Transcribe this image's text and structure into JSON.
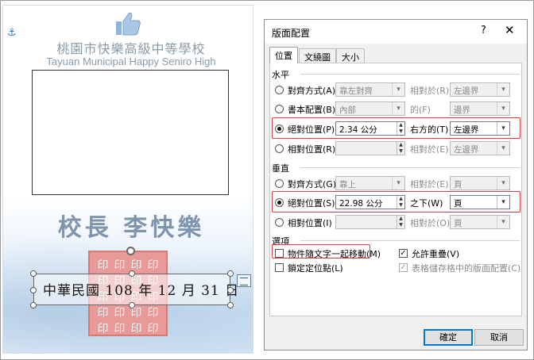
{
  "document": {
    "school_name_cn": "桃園市快樂高級中等學校",
    "school_name_en": "Tayuan Municipal Happy Seniro High School",
    "principal": "校長 李快樂",
    "date_text": "中華民國 108 年 12 月 31 日",
    "seal_char": "印",
    "icons": [
      "anchor-icon",
      "thumbs-up-icon",
      "layout-options-icon",
      "rotate-handle-icon"
    ]
  },
  "dialog": {
    "title": "版面配置",
    "help": "?",
    "close": "✕",
    "tabs": [
      "位置",
      "文繞圖",
      "大小"
    ],
    "horizontal": {
      "section": "水平",
      "align": {
        "label": "對齊方式(A)",
        "value": "靠左對齊",
        "rel_label": "相對於(R)",
        "rel_value": "左邊界"
      },
      "book": {
        "label": "書本配置(B)",
        "value": "內部",
        "rel_label": "的(F)",
        "rel_value": "邊界"
      },
      "absolute": {
        "label": "絕對位置(P)",
        "value": "2.34 公分",
        "rel_label": "右方的(T)",
        "rel_value": "左邊界"
      },
      "relative": {
        "label": "相對位置(R)",
        "value": "",
        "rel_label": "相對於(E)",
        "rel_value": "左邊界"
      }
    },
    "vertical": {
      "section": "垂直",
      "align": {
        "label": "對齊方式(G)",
        "value": "靠上",
        "rel_label": "相對於(E)",
        "rel_value": "頁"
      },
      "absolute": {
        "label": "絕對位置(S)",
        "value": "22.98 公分",
        "rel_label": "之下(W)",
        "rel_value": "頁"
      },
      "relative": {
        "label": "相對位置(I)",
        "value": "",
        "rel_label": "相對於(O)",
        "rel_value": "頁"
      }
    },
    "options": {
      "section": "選項",
      "move_with_text": "物件隨文字一起移動(M)",
      "lock_anchor": "鎖定定位點(L)",
      "allow_overlap": "允許重疊(V)",
      "layout_in_table": "表格儲存格中的版面配置(C)"
    },
    "ok": "確定",
    "cancel": "取消"
  }
}
